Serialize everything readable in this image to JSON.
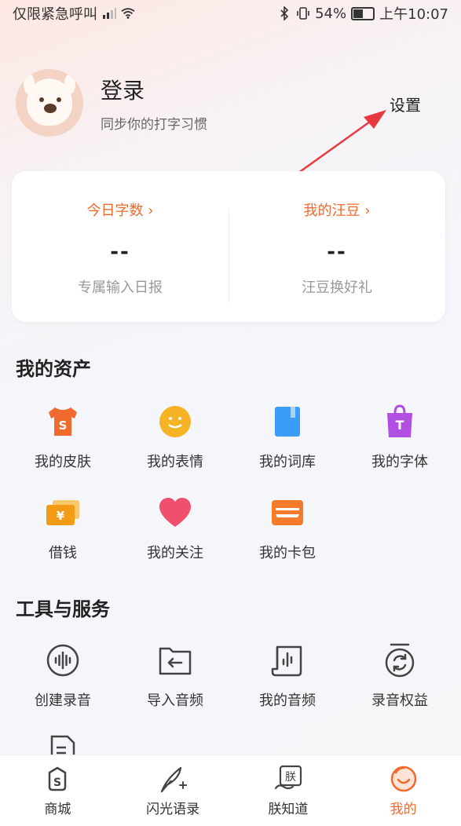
{
  "status": {
    "left_text": "仅限紧急呼叫",
    "battery": "54%",
    "time": "上午10:07"
  },
  "profile": {
    "login_label": "登录",
    "subtitle": "同步你的打字习惯",
    "settings_label": "设置"
  },
  "stats": [
    {
      "title": "今日字数 ›",
      "value": "--",
      "desc": "专属输入日报"
    },
    {
      "title": "我的汪豆 ›",
      "value": "--",
      "desc": "汪豆换好礼"
    }
  ],
  "assets": {
    "title": "我的资产",
    "items": [
      {
        "label": "我的皮肤",
        "icon": "tshirt-icon"
      },
      {
        "label": "我的表情",
        "icon": "smiley-icon"
      },
      {
        "label": "我的词库",
        "icon": "book-icon"
      },
      {
        "label": "我的字体",
        "icon": "font-bag-icon"
      },
      {
        "label": "借钱",
        "icon": "money-icon"
      },
      {
        "label": "我的关注",
        "icon": "heart-icon"
      },
      {
        "label": "我的卡包",
        "icon": "card-wallet-icon"
      }
    ]
  },
  "tools": {
    "title": "工具与服务",
    "items": [
      {
        "label": "创建录音",
        "icon": "record-icon"
      },
      {
        "label": "导入音频",
        "icon": "import-audio-icon"
      },
      {
        "label": "我的音频",
        "icon": "my-audio-icon"
      },
      {
        "label": "录音权益",
        "icon": "recording-rights-icon"
      }
    ]
  },
  "nav": [
    {
      "label": "商城",
      "icon": "shop-icon"
    },
    {
      "label": "闪光语录",
      "icon": "quill-icon"
    },
    {
      "label": "朕知道",
      "icon": "zhen-icon"
    },
    {
      "label": "我的",
      "icon": "profile-icon"
    }
  ],
  "colors": {
    "accent": "#f06a2d",
    "arrow": "#e8383d"
  }
}
